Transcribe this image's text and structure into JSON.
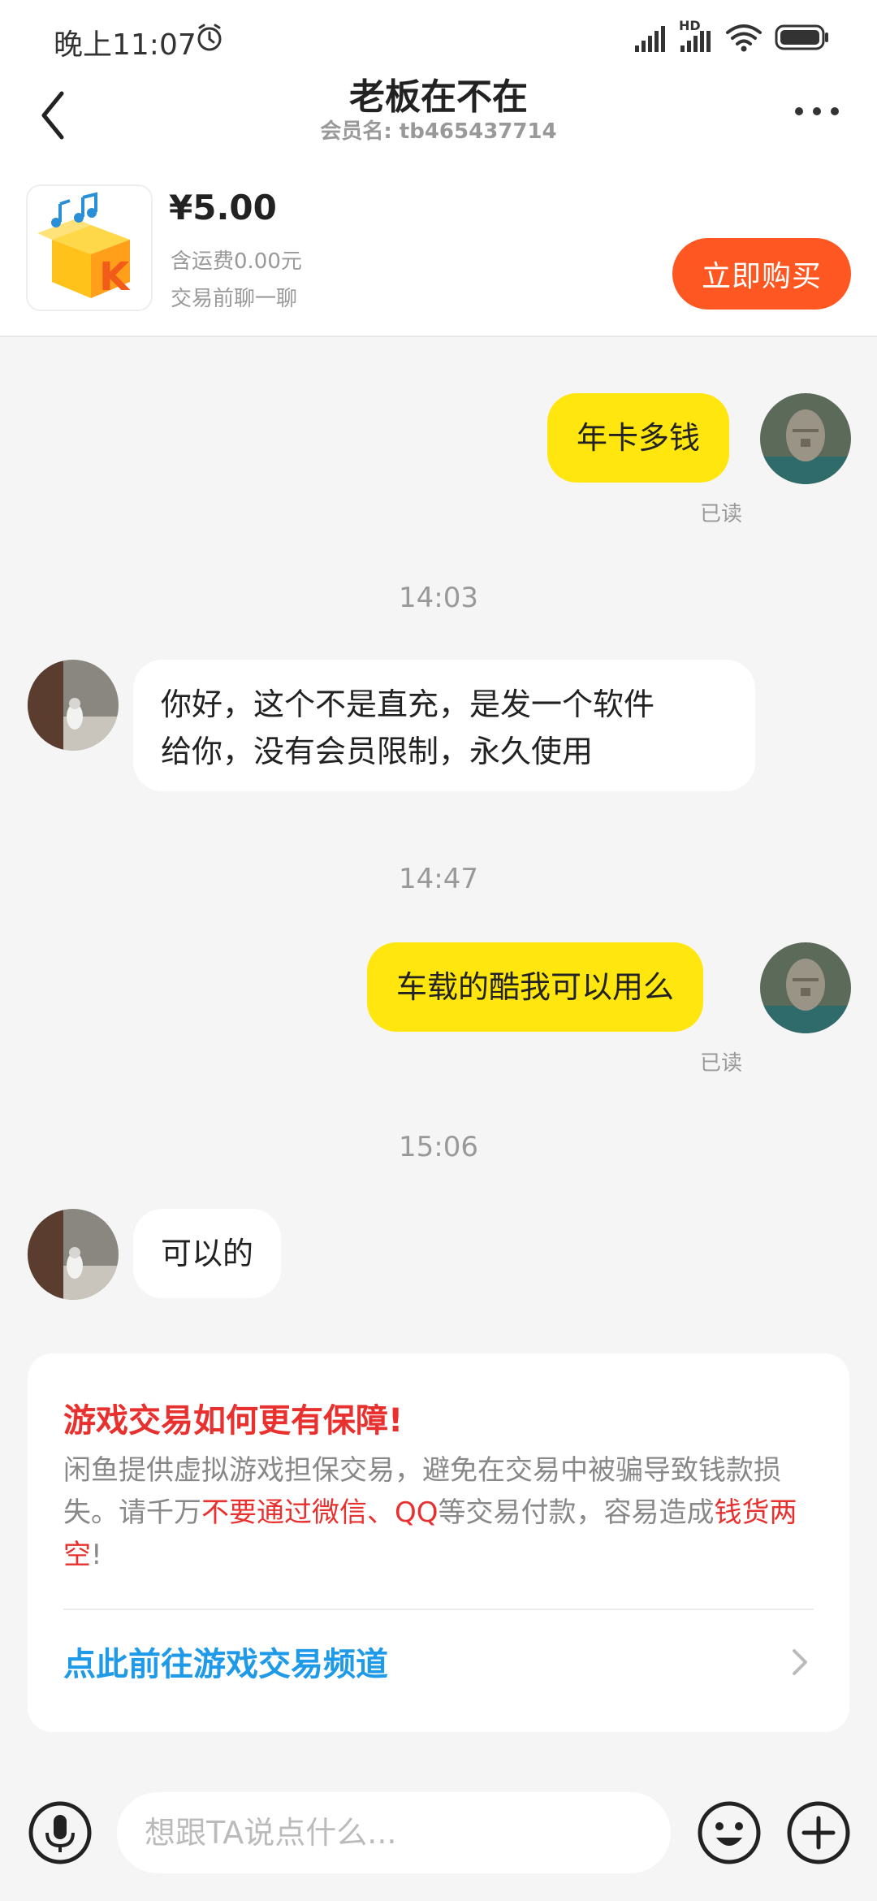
{
  "status_bar": {
    "time": "晚上11:07",
    "hd_label": "HD",
    "icons": [
      "alarm-icon",
      "signal-icon",
      "signal-hd-icon",
      "wifi-icon",
      "battery-icon"
    ]
  },
  "header": {
    "title": "老板在不在",
    "subtitle": "会员名: tb465437714",
    "icons": [
      "chevron-left-icon",
      "more-icon"
    ]
  },
  "product": {
    "price": "¥5.00",
    "shipping": "含运费0.00元",
    "note": "交易前聊一聊",
    "buy_label": "立即购买",
    "brand_color": "#ff5722"
  },
  "messages": [
    {
      "sender": "me",
      "text": "年卡多钱",
      "status": "已读"
    },
    {
      "time": "14:03"
    },
    {
      "sender": "them",
      "lines": [
        "你好，这个不是直充，是发一个软件",
        "给你，没有会员限制，永久使用"
      ]
    },
    {
      "time": "14:47"
    },
    {
      "sender": "me",
      "text": "车载的酷我可以用么",
      "status": "已读"
    },
    {
      "time": "15:06"
    },
    {
      "sender": "them",
      "text": "可以的"
    }
  ],
  "notice": {
    "title": "游戏交易如何更有保障!",
    "body_1": "闲鱼提供虚拟游戏担保交易，避免在交易中被骗导致钱款损失。请千万",
    "body_red_1": "不要通过微信、QQ",
    "body_2": "等交易付款，容易造成",
    "body_red_2": "钱货两空",
    "body_3": "!",
    "link_label": "点此前往游戏交易频道",
    "title_color": "#e8312f",
    "link_color": "#1e9ae8"
  },
  "input_bar": {
    "placeholder": "想跟TA说点什么...",
    "icons": [
      "microphone-icon",
      "emoji-icon",
      "plus-icon"
    ]
  },
  "colors": {
    "my_bubble": "#ffe60f",
    "their_bubble": "#ffffff",
    "background": "#f5f5f5"
  }
}
